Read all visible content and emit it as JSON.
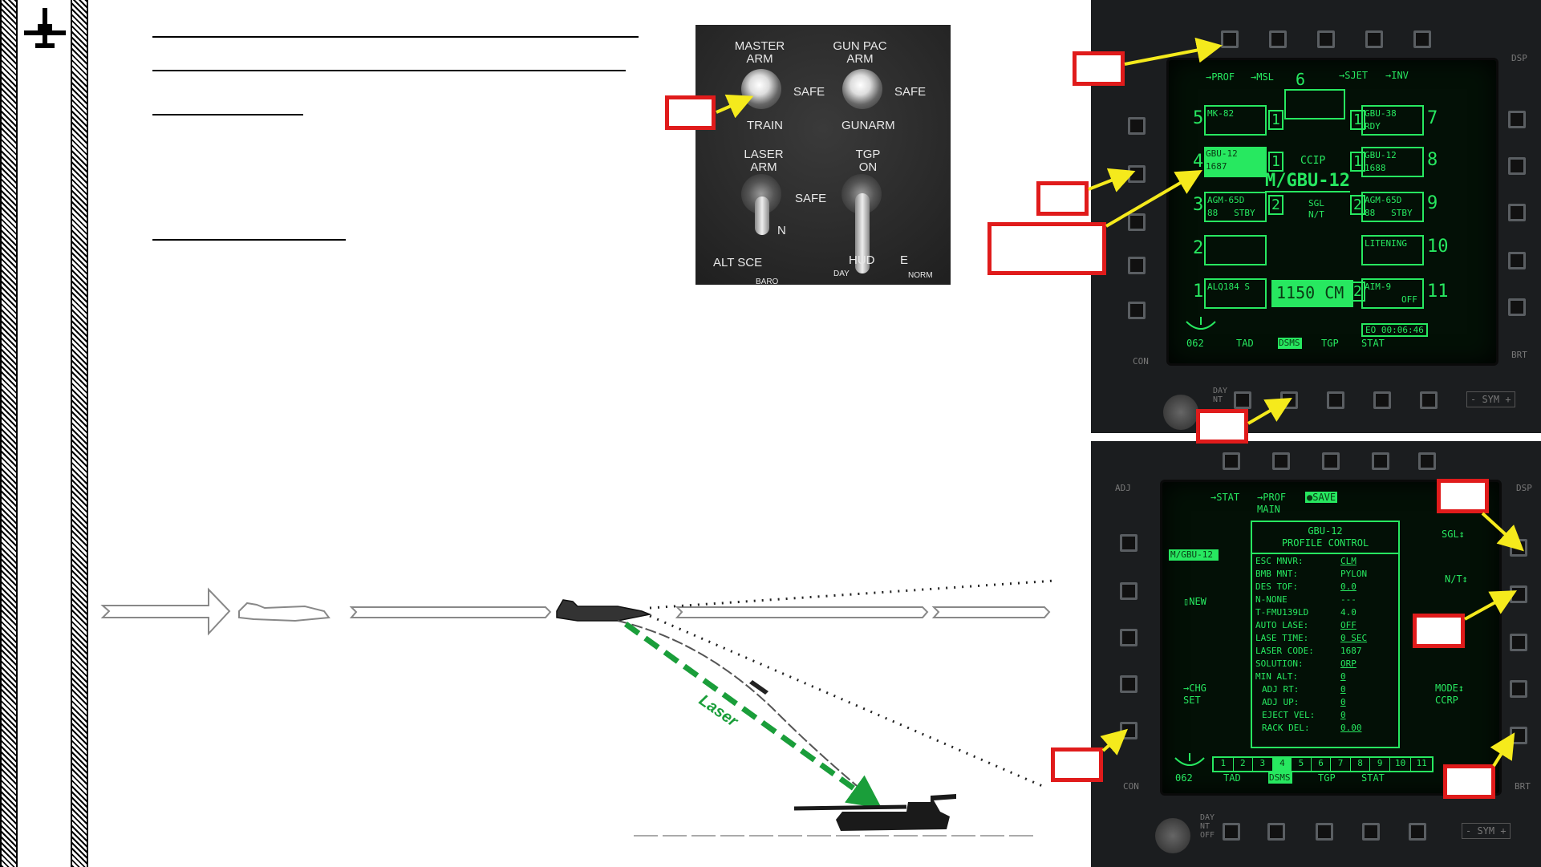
{
  "armament_panel": {
    "master_arm": "MASTER\nARM",
    "gun_pac_arm": "GUN PAC\nARM",
    "safe1": "SAFE",
    "safe2": "SAFE",
    "train": "TRAIN",
    "gunarm": "GUNARM",
    "laser_arm": "LASER\nARM",
    "tgp_on": "TGP\nON",
    "safe3": "SAFE",
    "n": "N",
    "alt_sce": "ALT SCE",
    "hud": "HUD",
    "e": "E",
    "day": "DAY",
    "norm": "NORM",
    "baro": "BARO"
  },
  "dsms_page": {
    "top_labels": [
      "→PROF",
      "→MSL",
      "6",
      "→SJET",
      "→INV"
    ],
    "stations": [
      {
        "num": "5",
        "name": "MK-82",
        "line2": "",
        "qty": "1"
      },
      {
        "num": "4",
        "name": "GBU-12",
        "line2": "1687",
        "qty": "1"
      },
      {
        "num": "3",
        "name": "AGM-65D",
        "line2": "88   STBY",
        "qty": "2"
      },
      {
        "num": "2",
        "name": "",
        "line2": "",
        "qty": ""
      },
      {
        "num": "1",
        "name": "ALQ184 S",
        "line2": "",
        "qty": ""
      },
      {
        "num": "7",
        "name": "GBU-38",
        "line2": "RDY",
        "qty": "1"
      },
      {
        "num": "8",
        "name": "GBU-12",
        "line2": "1688",
        "qty": "1"
      },
      {
        "num": "9",
        "name": "AGM-65D",
        "line2": "88   STBY",
        "qty": "2"
      },
      {
        "num": "10",
        "name": "LITENING",
        "line2": "",
        "qty": ""
      },
      {
        "num": "11",
        "name": "AIM-9",
        "line2": "OFF",
        "qty": "2"
      }
    ],
    "mode": "CCIP",
    "profile": "M/GBU-12",
    "sgl": "SGL",
    "nt": "N/T",
    "cm": "1150 CM",
    "clock": "EO 00:06:46",
    "heading": "062",
    "bottom_labels": [
      "TAD",
      "DSMS",
      "TGP",
      "STAT"
    ]
  },
  "profile_page": {
    "top_labels": [
      "→STAT",
      "→PROF\nMAIN",
      "●SAVE"
    ],
    "title": "GBU-12\nPROFILE CONTROL",
    "rows": [
      {
        "k": "ESC MNVR:",
        "v": "CLM"
      },
      {
        "k": "BMB MNT:",
        "v": "PYLON"
      },
      {
        "k": "DES TOF:",
        "v": "0.0"
      },
      {
        "k": "N-NONE",
        "v": "---"
      },
      {
        "k": "T-FMU139LD",
        "v": "4.0"
      },
      {
        "k": "AUTO LASE:",
        "v": "OFF"
      },
      {
        "k": "LASE TIME:",
        "v": "0 SEC"
      },
      {
        "k": "LASER CODE:",
        "v": "1687"
      },
      {
        "k": "SOLUTION:",
        "v": "ORP"
      },
      {
        "k": "MIN ALT:",
        "v": "0"
      },
      {
        "k": "ADJ RT:",
        "v": "0"
      },
      {
        "k": "ADJ UP:",
        "v": "0"
      },
      {
        "k": "EJECT VEL:",
        "v": "0"
      },
      {
        "k": "RACK DEL:",
        "v": "0.00"
      }
    ],
    "left_labels": [
      "M/GBU-12",
      "▯NEW",
      "→CHG\nSET"
    ],
    "right_labels": [
      "SGL↕",
      "N/T↕",
      "MODE↕\nCCRP"
    ],
    "pages": [
      "1",
      "2",
      "3",
      "4",
      "5",
      "6",
      "7",
      "8",
      "9",
      "10",
      "11"
    ],
    "heading": "062",
    "bottom_labels": [
      "TAD",
      "DSMS",
      "TGP",
      "STAT"
    ]
  },
  "bezel": {
    "dsp": "DSP",
    "con": "CON",
    "adj": "ADJ",
    "brt": "BRT",
    "sym": "- SYM +",
    "day_nt": "DAY\nNT",
    "day_nt_off": "DAY\nNT\nOFF"
  },
  "diagram": {
    "laser_label": "Laser"
  }
}
